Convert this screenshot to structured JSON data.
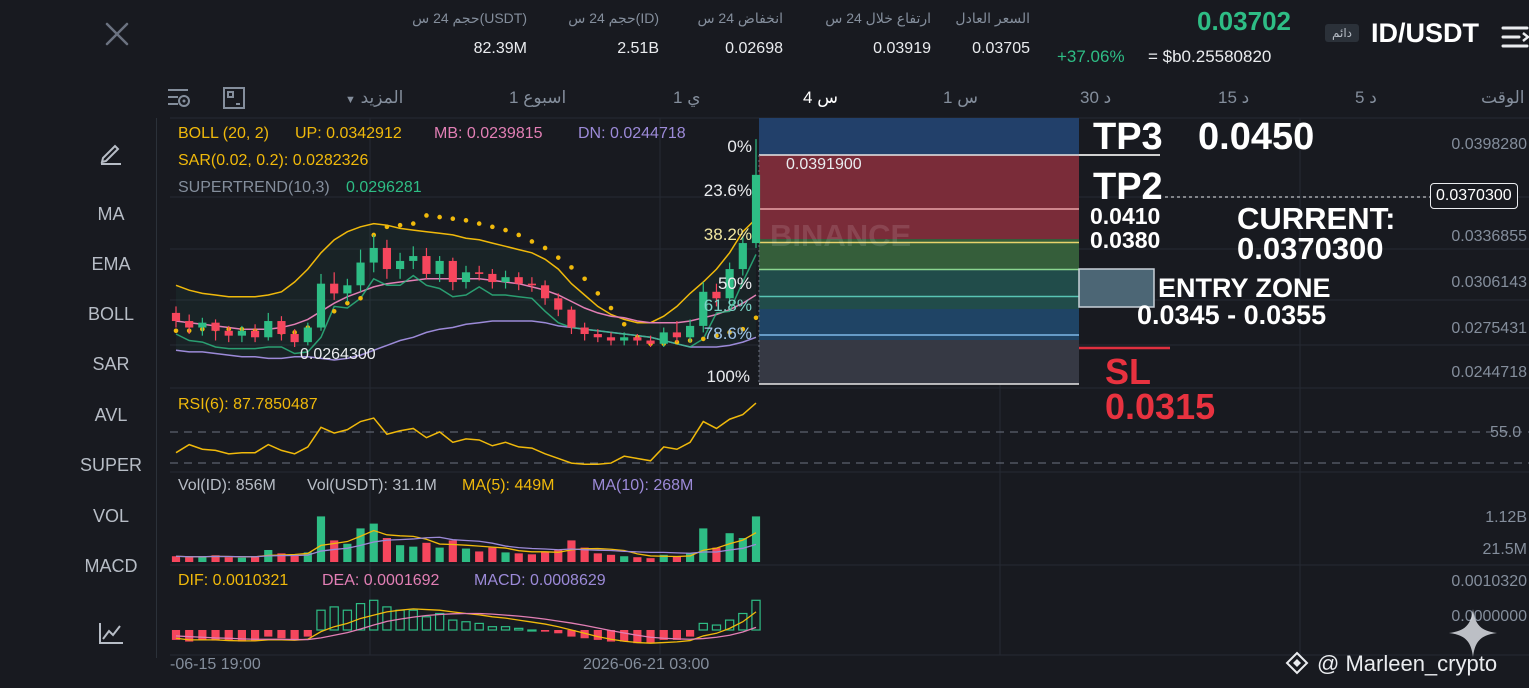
{
  "header": {
    "pair": "ID/USDT",
    "perp_badge": "دائم",
    "last_price": "0.03702",
    "change_pct": "+37.06%",
    "usd_price": "= $b0.25580820",
    "stats": [
      {
        "label": "السعر العادل",
        "value": "0.03705"
      },
      {
        "label": "ارتفاع خلال 24 س",
        "value": "0.03919"
      },
      {
        "label": "انخفاض 24 س",
        "value": "0.02698"
      },
      {
        "label": "حجم 24 س(ID)",
        "value": "2.51B"
      },
      {
        "label": "حجم 24 س(USDT)",
        "value": "82.39M"
      }
    ]
  },
  "timeframes": {
    "time_label": "الوقت",
    "items": [
      "5 د",
      "15 د",
      "30 د",
      "1 س",
      "4 س",
      "1 ي",
      "1 اسبوع"
    ],
    "active": "4 س",
    "more": "المزيد"
  },
  "sidebar": [
    "MA",
    "EMA",
    "BOLL",
    "SAR",
    "AVL",
    "SUPER",
    "VOL",
    "MACD"
  ],
  "indicators": {
    "boll": {
      "name": "BOLL (20, 2)",
      "up": "UP: 0.0342912",
      "mb": "MB: 0.0239815",
      "dn": "DN: 0.0244718"
    },
    "sar": "SAR(0.02, 0.2): 0.0282326",
    "supertrend_label": "SUPERTREND(10,3)",
    "supertrend_value": "0.0296281",
    "rsi": "RSI(6): 87.7850487",
    "vol": {
      "id": "Vol(ID): 856M",
      "usdt": "Vol(USDT): 31.1M",
      "ma5": "MA(5): 449M",
      "ma10": "MA(10): 268M"
    },
    "macd": {
      "dif": "DIF: 0.0010321",
      "dea": "DEA: 0.0001692",
      "macd": "MACD: 0.0008629"
    }
  },
  "price_axis": [
    "0.0398280",
    "0.0336855",
    "0.0306143",
    "0.0275431",
    "0.0244718"
  ],
  "current_price_tag": "0.0370300",
  "rsi_axis": "55.0",
  "vol_axis": [
    "1.12B",
    "21.5M"
  ],
  "macd_axis": [
    "0.0010320",
    "0.0000000"
  ],
  "time_axis": [
    "-06-15 19:00",
    "2026-06-21 03:00"
  ],
  "chart_labels": {
    "high": "0.0391900",
    "low": "0.0264300"
  },
  "watermark": "BINANCE",
  "fib_levels": [
    {
      "label": "0%",
      "value": 0.0
    },
    {
      "label": "23.6%",
      "value": 0.236
    },
    {
      "label": "38.2%",
      "value": 0.382
    },
    {
      "label": "50%",
      "value": 0.5
    },
    {
      "label": "61.8%",
      "value": 0.618
    },
    {
      "label": "78.6%",
      "value": 0.786
    },
    {
      "label": "100%",
      "value": 1.0
    }
  ],
  "annotations": {
    "tp3_label": "TP3",
    "tp3_value": "0.0450",
    "tp2_label": "TP2",
    "tp2_values": [
      "0.0410",
      "0.0380"
    ],
    "current_label": "CURRENT:",
    "current_value": "0.0370300",
    "entry_label": "ENTRY ZONE",
    "entry_value": "0.0345 - 0.0355",
    "sl_label": "SL",
    "sl_value": "0.0315"
  },
  "footer_credit": "@ Marleen_crypto",
  "colors": {
    "up": "#2ebd85",
    "down": "#f6465d",
    "boll_up": "#f0b90b",
    "boll_mb": "#e27fb5",
    "boll_dn": "#9c8ad8",
    "rsi": "#f0b90b"
  },
  "candles": [
    {
      "o": 0.0285,
      "c": 0.028,
      "h": 0.0289,
      "l": 0.0276
    },
    {
      "o": 0.028,
      "c": 0.0276,
      "h": 0.0284,
      "l": 0.0272
    },
    {
      "o": 0.0276,
      "c": 0.0279,
      "h": 0.0282,
      "l": 0.0271
    },
    {
      "o": 0.0279,
      "c": 0.0274,
      "h": 0.0281,
      "l": 0.0268
    },
    {
      "o": 0.0274,
      "c": 0.0271,
      "h": 0.0277,
      "l": 0.0267
    },
    {
      "o": 0.0271,
      "c": 0.0274,
      "h": 0.0277,
      "l": 0.0267
    },
    {
      "o": 0.0274,
      "c": 0.027,
      "h": 0.0278,
      "l": 0.0267
    },
    {
      "o": 0.027,
      "c": 0.028,
      "h": 0.0285,
      "l": 0.0268
    },
    {
      "o": 0.028,
      "c": 0.0272,
      "h": 0.0283,
      "l": 0.0268
    },
    {
      "o": 0.0272,
      "c": 0.0267,
      "h": 0.0275,
      "l": 0.0264
    },
    {
      "o": 0.0267,
      "c": 0.0276,
      "h": 0.0279,
      "l": 0.0265
    },
    {
      "o": 0.0276,
      "c": 0.0303,
      "h": 0.0309,
      "l": 0.0274
    },
    {
      "o": 0.0303,
      "c": 0.0297,
      "h": 0.031,
      "l": 0.0293
    },
    {
      "o": 0.0297,
      "c": 0.0302,
      "h": 0.0306,
      "l": 0.0292
    },
    {
      "o": 0.0302,
      "c": 0.0316,
      "h": 0.0324,
      "l": 0.0298
    },
    {
      "o": 0.0316,
      "c": 0.0325,
      "h": 0.0333,
      "l": 0.031
    },
    {
      "o": 0.0325,
      "c": 0.0312,
      "h": 0.033,
      "l": 0.0306
    },
    {
      "o": 0.0312,
      "c": 0.0317,
      "h": 0.0322,
      "l": 0.0306
    },
    {
      "o": 0.0317,
      "c": 0.032,
      "h": 0.0326,
      "l": 0.0312
    },
    {
      "o": 0.032,
      "c": 0.0309,
      "h": 0.0325,
      "l": 0.0306
    },
    {
      "o": 0.0309,
      "c": 0.0317,
      "h": 0.032,
      "l": 0.0304
    },
    {
      "o": 0.0317,
      "c": 0.0304,
      "h": 0.0319,
      "l": 0.0299
    },
    {
      "o": 0.0304,
      "c": 0.031,
      "h": 0.0314,
      "l": 0.03
    },
    {
      "o": 0.031,
      "c": 0.0309,
      "h": 0.0314,
      "l": 0.0305
    },
    {
      "o": 0.0309,
      "c": 0.0304,
      "h": 0.0312,
      "l": 0.03
    },
    {
      "o": 0.0304,
      "c": 0.0307,
      "h": 0.0311,
      "l": 0.03
    },
    {
      "o": 0.0307,
      "c": 0.0303,
      "h": 0.031,
      "l": 0.0299
    },
    {
      "o": 0.0303,
      "c": 0.0302,
      "h": 0.0307,
      "l": 0.0298
    },
    {
      "o": 0.0302,
      "c": 0.0294,
      "h": 0.0305,
      "l": 0.029
    },
    {
      "o": 0.0294,
      "c": 0.0287,
      "h": 0.0297,
      "l": 0.0283
    },
    {
      "o": 0.0287,
      "c": 0.0276,
      "h": 0.0289,
      "l": 0.0272
    },
    {
      "o": 0.0276,
      "c": 0.0272,
      "h": 0.0279,
      "l": 0.0268
    },
    {
      "o": 0.0272,
      "c": 0.027,
      "h": 0.0275,
      "l": 0.0267
    },
    {
      "o": 0.027,
      "c": 0.0268,
      "h": 0.0273,
      "l": 0.0265
    },
    {
      "o": 0.0268,
      "c": 0.027,
      "h": 0.0273,
      "l": 0.0265
    },
    {
      "o": 0.027,
      "c": 0.0268,
      "h": 0.0272,
      "l": 0.0265
    },
    {
      "o": 0.0268,
      "c": 0.0266,
      "h": 0.0271,
      "l": 0.0264
    },
    {
      "o": 0.0266,
      "c": 0.0273,
      "h": 0.0276,
      "l": 0.0264
    },
    {
      "o": 0.0273,
      "c": 0.027,
      "h": 0.028,
      "l": 0.0267
    },
    {
      "o": 0.027,
      "c": 0.0277,
      "h": 0.0281,
      "l": 0.0267
    },
    {
      "o": 0.0277,
      "c": 0.0298,
      "h": 0.0304,
      "l": 0.0273
    },
    {
      "o": 0.0298,
      "c": 0.0294,
      "h": 0.0303,
      "l": 0.0289
    },
    {
      "o": 0.0294,
      "c": 0.0312,
      "h": 0.0316,
      "l": 0.029
    },
    {
      "o": 0.0312,
      "c": 0.0328,
      "h": 0.0332,
      "l": 0.0308
    },
    {
      "o": 0.0328,
      "c": 0.037,
      "h": 0.0392,
      "l": 0.0325
    }
  ],
  "boll_up": [
    0.0302,
    0.0299,
    0.0297,
    0.0296,
    0.0295,
    0.0295,
    0.0295,
    0.0296,
    0.0298,
    0.0304,
    0.0312,
    0.0322,
    0.033,
    0.0335,
    0.0338,
    0.034,
    0.0339,
    0.0337,
    0.0336,
    0.0335,
    0.0334,
    0.0333,
    0.0331,
    0.033,
    0.0328,
    0.0326,
    0.0324,
    0.0322,
    0.0318,
    0.0312,
    0.0303,
    0.0296,
    0.0289,
    0.0284,
    0.0281,
    0.0279,
    0.0279,
    0.0283,
    0.0289,
    0.0297,
    0.0304,
    0.0312,
    0.0322,
    0.0335,
    0.0343
  ],
  "boll_mb": [
    0.028,
    0.0279,
    0.0278,
    0.0277,
    0.0276,
    0.0275,
    0.0275,
    0.0275,
    0.0276,
    0.0278,
    0.0281,
    0.0286,
    0.0291,
    0.0295,
    0.0298,
    0.0301,
    0.0303,
    0.0304,
    0.0305,
    0.0306,
    0.0306,
    0.0306,
    0.0306,
    0.0306,
    0.0305,
    0.0304,
    0.0303,
    0.0301,
    0.0299,
    0.0296,
    0.0292,
    0.0288,
    0.0285,
    0.0283,
    0.0282,
    0.028,
    0.0279,
    0.0279,
    0.0279,
    0.028,
    0.0282,
    0.0284,
    0.0287,
    0.0291,
    0.0296
  ],
  "boll_dn": [
    0.0262,
    0.0261,
    0.0261,
    0.026,
    0.0259,
    0.0258,
    0.0258,
    0.0257,
    0.0257,
    0.0258,
    0.0258,
    0.0257,
    0.0256,
    0.0257,
    0.0259,
    0.0262,
    0.0265,
    0.0268,
    0.027,
    0.0273,
    0.0275,
    0.0276,
    0.0278,
    0.0279,
    0.028,
    0.028,
    0.028,
    0.028,
    0.0279,
    0.0277,
    0.0276,
    0.0275,
    0.0274,
    0.0273,
    0.0272,
    0.0271,
    0.027,
    0.0268,
    0.0266,
    0.0264,
    0.0264,
    0.0264,
    0.0265,
    0.0267,
    0.027
  ],
  "sar_points": [
    0.0274,
    0.0274,
    0.0275,
    0.0275,
    0.0275,
    0.0275,
    0.0274,
    0.0274,
    0.0273,
    0.0273,
    0.0276,
    0.0279,
    0.0286,
    0.0291,
    0.0294,
    0.0333,
    0.0338,
    0.0339,
    0.034,
    0.0345,
    0.0344,
    0.0343,
    0.0342,
    0.034,
    0.0338,
    0.0336,
    0.0333,
    0.0329,
    0.0325,
    0.0319,
    0.0313,
    0.0306,
    0.0297,
    0.0288,
    0.0278,
    0.027,
    0.0266,
    0.0266,
    0.0267,
    0.0268,
    0.0269,
    0.0271,
    0.0273,
    0.0275,
    0.0282
  ],
  "rsi": [
    45,
    52,
    48,
    47,
    44,
    45,
    45,
    52,
    47,
    44,
    50,
    67,
    62,
    65,
    72,
    75,
    61,
    64,
    66,
    58,
    63,
    54,
    57,
    56,
    51,
    54,
    50,
    49,
    44,
    40,
    36,
    35,
    35,
    36,
    42,
    40,
    38,
    50,
    48,
    54,
    72,
    66,
    74,
    78,
    88
  ],
  "volume": [
    12,
    10,
    11,
    14,
    10,
    9,
    11,
    25,
    18,
    15,
    20,
    95,
    45,
    38,
    70,
    80,
    50,
    35,
    32,
    40,
    30,
    45,
    28,
    22,
    30,
    20,
    18,
    16,
    22,
    25,
    45,
    30,
    18,
    15,
    12,
    10,
    8,
    15,
    12,
    18,
    70,
    30,
    60,
    50,
    95
  ],
  "macd_hist": [
    -3,
    -3.5,
    -3,
    -3.2,
    -3.3,
    -3.5,
    -3.2,
    -2,
    -2.5,
    -3,
    -2,
    6,
    7,
    6,
    8,
    9,
    7,
    6,
    6,
    4,
    5,
    3,
    2.5,
    2,
    1,
    1,
    0.5,
    0,
    -0.5,
    -1,
    -2,
    -2.5,
    -3,
    -3.5,
    -3.5,
    -4,
    -4,
    -3,
    -3,
    -2,
    2,
    1.5,
    3,
    5,
    9
  ],
  "macd_dif": [
    -2.5,
    -3,
    -3,
    -3,
    -3.2,
    -3.3,
    -3.3,
    -3,
    -3,
    -3.1,
    -2.8,
    -0.5,
    1,
    2,
    3.5,
    4.5,
    5.5,
    6,
    6.4,
    6.2,
    6,
    5.5,
    5,
    4.6,
    4,
    3.6,
    3,
    2.4,
    1.8,
    1,
    0,
    -1,
    -2,
    -2.8,
    -3.4,
    -3.8,
    -4,
    -3.8,
    -3.6,
    -3.2,
    -1.8,
    -1,
    0.5,
    2.5,
    5.5
  ],
  "macd_dea": [
    -1.8,
    -2,
    -2.2,
    -2.4,
    -2.5,
    -2.7,
    -2.8,
    -2.8,
    -2.8,
    -2.9,
    -2.9,
    -2.4,
    -1.6,
    -0.8,
    0.3,
    1.5,
    2.6,
    3.3,
    3.9,
    4.4,
    4.7,
    4.9,
    5,
    5,
    4.8,
    4.5,
    4.2,
    3.8,
    3.3,
    2.7,
    2.1,
    1.4,
    0.6,
    -0.2,
    -0.9,
    -1.6,
    -2.2,
    -2.5,
    -2.7,
    -2.8,
    -2.6,
    -2.2,
    -1.6,
    -0.6,
    0.8
  ]
}
